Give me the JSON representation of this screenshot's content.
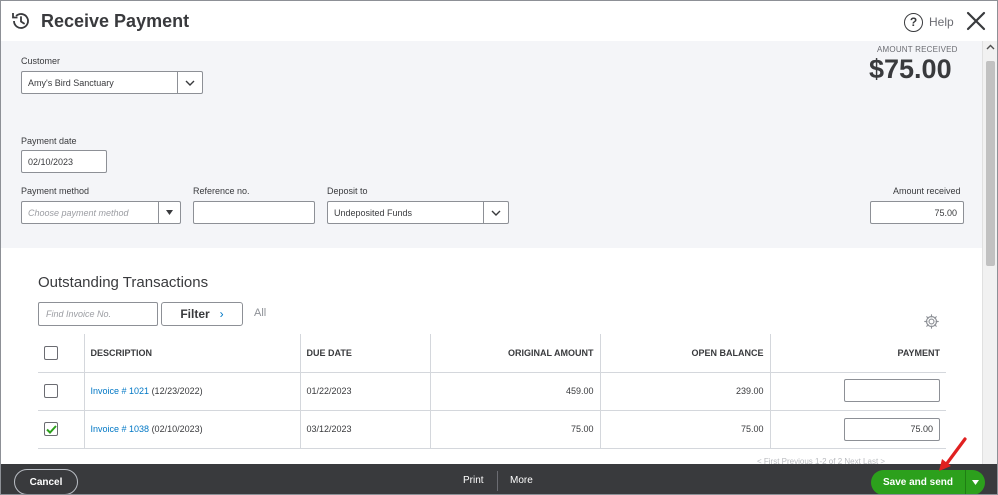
{
  "header": {
    "title": "Receive Payment",
    "help_label": "Help"
  },
  "customer": {
    "label": "Customer",
    "value": "Amy's Bird Sanctuary"
  },
  "amount_display": {
    "caption": "AMOUNT RECEIVED",
    "value": "$75.00"
  },
  "payment_date": {
    "label": "Payment date",
    "value": "02/10/2023"
  },
  "payment_method": {
    "label": "Payment method",
    "placeholder": "Choose payment method"
  },
  "reference": {
    "label": "Reference no.",
    "value": ""
  },
  "deposit_to": {
    "label": "Deposit to",
    "value": "Undeposited Funds"
  },
  "amount_received": {
    "label": "Amount received",
    "value": "75.00"
  },
  "outstanding": {
    "title": "Outstanding Transactions",
    "find_placeholder": "Find Invoice No.",
    "filter_label": "Filter",
    "all_label": "All",
    "columns": {
      "description": "DESCRIPTION",
      "due_date": "DUE DATE",
      "original_amount": "ORIGINAL AMOUNT",
      "open_balance": "OPEN BALANCE",
      "payment": "PAYMENT"
    },
    "rows": [
      {
        "checked": false,
        "invoice": "Invoice # 1021",
        "invoice_date": "(12/23/2022)",
        "due_date": "01/22/2023",
        "original_amount": "459.00",
        "open_balance": "239.00",
        "payment": ""
      },
      {
        "checked": true,
        "invoice": "Invoice # 1038",
        "invoice_date": "(02/10/2023)",
        "due_date": "03/12/2023",
        "original_amount": "75.00",
        "open_balance": "75.00",
        "payment": "75.00"
      }
    ],
    "pagination": "< First   Previous   1-2 of 2   Next   Last >"
  },
  "footer": {
    "cancel_label": "Cancel",
    "print_label": "Print",
    "more_label": "More",
    "save_label": "Save and send"
  },
  "colors": {
    "primary_green": "#2ca01c",
    "link_blue": "#0077c5",
    "footer_bg": "#393a3d",
    "form_bg": "#f4f5f8",
    "annotation_red": "#e02020"
  }
}
